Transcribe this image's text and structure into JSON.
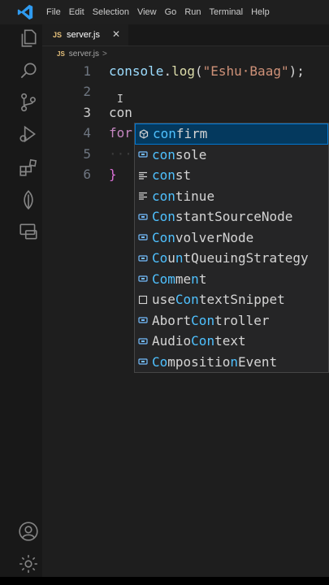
{
  "menu": [
    "File",
    "Edit",
    "Selection",
    "View",
    "Go",
    "Run",
    "Terminal",
    "Help"
  ],
  "activity_icons": [
    "explorer-icon",
    "search-icon",
    "source-control-icon",
    "run-debug-icon",
    "extensions-icon",
    "leaf-icon",
    "remote-explorer-icon",
    "account-icon",
    "settings-gear-icon"
  ],
  "tab": {
    "badge": "JS",
    "label": "server.js",
    "close": "✕"
  },
  "breadcrumb": {
    "badge": "JS",
    "file": "server.js",
    "sep": ">"
  },
  "editor": {
    "lines": [
      {
        "num": "1",
        "parts": [
          {
            "t": "console",
            "c": "tok-obj"
          },
          {
            "t": ".",
            "c": ""
          },
          {
            "t": "log",
            "c": "tok-fn"
          },
          {
            "t": "(",
            "c": ""
          },
          {
            "t": "\"Eshu·Baag\"",
            "c": "tok-str"
          },
          {
            "t": ");",
            "c": ""
          }
        ]
      },
      {
        "num": "2",
        "parts": []
      },
      {
        "num": "3",
        "parts": [
          {
            "t": "con",
            "c": ""
          }
        ],
        "active": true
      },
      {
        "num": "4",
        "parts": [
          {
            "t": "for",
            "c": "tok-kw"
          }
        ]
      },
      {
        "num": "5",
        "parts": [
          {
            "t": "····",
            "c": "ws-dots"
          }
        ]
      },
      {
        "num": "6",
        "parts": [
          {
            "t": "}",
            "c": "tok-brace"
          }
        ]
      }
    ],
    "cursor_glyph": "I"
  },
  "suggestions": [
    {
      "icon": "method",
      "parts": [
        {
          "t": "con",
          "h": true
        },
        {
          "t": "firm",
          "h": false
        }
      ],
      "selected": true
    },
    {
      "icon": "variable",
      "parts": [
        {
          "t": "con",
          "h": true
        },
        {
          "t": "sole",
          "h": false
        }
      ]
    },
    {
      "icon": "keyword",
      "parts": [
        {
          "t": "con",
          "h": true
        },
        {
          "t": "st",
          "h": false
        }
      ]
    },
    {
      "icon": "keyword",
      "parts": [
        {
          "t": "con",
          "h": true
        },
        {
          "t": "tinue",
          "h": false
        }
      ]
    },
    {
      "icon": "variable",
      "parts": [
        {
          "t": "Con",
          "h": true
        },
        {
          "t": "stantSourceNode",
          "h": false
        }
      ]
    },
    {
      "icon": "variable",
      "parts": [
        {
          "t": "Con",
          "h": true
        },
        {
          "t": "volverNode",
          "h": false
        }
      ]
    },
    {
      "icon": "variable",
      "parts": [
        {
          "t": "Co",
          "h": true
        },
        {
          "t": "u",
          "h": false
        },
        {
          "t": "n",
          "h": true
        },
        {
          "t": "tQueuingStrategy",
          "h": false
        }
      ]
    },
    {
      "icon": "variable",
      "parts": [
        {
          "t": "Com",
          "h": true
        },
        {
          "t": "me",
          "h": false
        },
        {
          "t": "n",
          "h": true
        },
        {
          "t": "t",
          "h": false
        }
      ]
    },
    {
      "icon": "snippet",
      "parts": [
        {
          "t": "use",
          "h": false
        },
        {
          "t": "Con",
          "h": true
        },
        {
          "t": "textSnippet",
          "h": false
        }
      ]
    },
    {
      "icon": "variable",
      "parts": [
        {
          "t": "Abort",
          "h": false
        },
        {
          "t": "Con",
          "h": true
        },
        {
          "t": "troller",
          "h": false
        }
      ]
    },
    {
      "icon": "variable",
      "parts": [
        {
          "t": "Audio",
          "h": false
        },
        {
          "t": "Con",
          "h": true
        },
        {
          "t": "text",
          "h": false
        }
      ]
    },
    {
      "icon": "variable",
      "parts": [
        {
          "t": "Co",
          "h": true
        },
        {
          "t": "mpositio",
          "h": false
        },
        {
          "t": "n",
          "h": true
        },
        {
          "t": "Event",
          "h": false
        }
      ]
    }
  ],
  "colors": {
    "accent": "#0078d4",
    "match": "#4fc1ff",
    "js_badge": "#e5c07b"
  }
}
